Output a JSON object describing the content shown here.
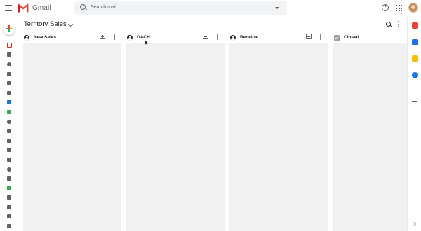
{
  "app": {
    "name": "Gmail",
    "brand_colors": [
      "#ea4335",
      "#c5221f",
      "#fbbc04",
      "#34a853",
      "#4285f4"
    ]
  },
  "search": {
    "placeholder": "Search mail"
  },
  "board": {
    "title": "Territory Sales",
    "columns": [
      {
        "name": "New Sales",
        "icon": "person-icon"
      },
      {
        "name": "DACH",
        "icon": "person-icon"
      },
      {
        "name": "Benelux",
        "icon": "person-icon"
      },
      {
        "name": "Closed",
        "icon": "checkbox-icon"
      }
    ]
  },
  "left_nav": {
    "icons": [
      {
        "name": "inbox-icon",
        "color": "#d93025",
        "selected": true
      },
      {
        "name": "star-icon",
        "color": "#5f6368"
      },
      {
        "name": "snoozed-icon",
        "color": "#5f6368"
      },
      {
        "name": "sent-icon",
        "color": "#5f6368"
      },
      {
        "name": "drafts-icon",
        "color": "#5f6368"
      },
      {
        "name": "streak-icon",
        "color": "#5f6368"
      },
      {
        "name": "streak-blue-icon",
        "color": "#1a73e8"
      },
      {
        "name": "streak-green-icon",
        "color": "#34a853"
      },
      {
        "name": "contacts-icon",
        "color": "#5f6368"
      },
      {
        "name": "pipeline-icon",
        "color": "#5f6368"
      },
      {
        "name": "pipeline-icon",
        "color": "#5f6368"
      },
      {
        "name": "pipeline-icon",
        "color": "#5f6368"
      },
      {
        "name": "pipeline-icon",
        "color": "#5f6368"
      },
      {
        "name": "smiley-icon",
        "color": "#5f6368"
      },
      {
        "name": "label-icon",
        "color": "#5f6368"
      },
      {
        "name": "label-green-icon",
        "color": "#34a853"
      },
      {
        "name": "label-icon",
        "color": "#5f6368"
      },
      {
        "name": "label-icon",
        "color": "#5f6368"
      },
      {
        "name": "label-icon",
        "color": "#5f6368"
      },
      {
        "name": "label-icon",
        "color": "#5f6368"
      }
    ]
  },
  "right_sidebar": {
    "apps": [
      {
        "name": "streak-app-icon",
        "color": "#ea4335"
      },
      {
        "name": "calendar-icon",
        "color": "#1a73e8"
      },
      {
        "name": "keep-icon",
        "color": "#fbbc04"
      },
      {
        "name": "tasks-icon",
        "color": "#1a73e8"
      }
    ]
  }
}
